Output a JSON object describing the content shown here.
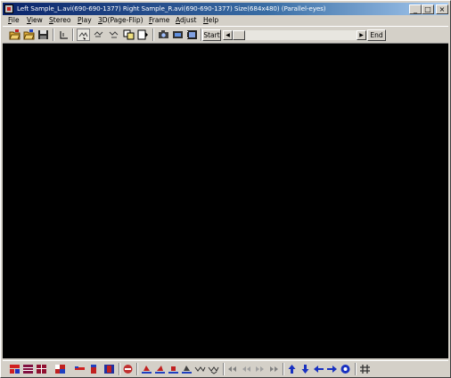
{
  "window": {
    "title": "Left Sample_L.avi(690-690-1377) Right Sample_R.avi(690-690-1377) Size(684x480)  (Parallel-eyes)",
    "controls": {
      "minimize": "_",
      "maximize": "□",
      "close": "×"
    }
  },
  "menu": [
    {
      "label": "File",
      "underline": "F",
      "rest": "ile"
    },
    {
      "label": "View",
      "underline": "V",
      "rest": "iew"
    },
    {
      "label": "Stereo",
      "underline": "S",
      "rest": "tereo"
    },
    {
      "label": "Play",
      "underline": "P",
      "rest": "lay"
    },
    {
      "label": "3D(Page-Flip)",
      "underline": "3",
      "rest": "D(Page-Flip)"
    },
    {
      "label": "Frame",
      "underline": "F",
      "rest": "rame"
    },
    {
      "label": "Adjust",
      "underline": "A",
      "rest": "djust"
    },
    {
      "label": "Help",
      "underline": "H",
      "rest": "elp"
    }
  ],
  "toolbar": {
    "start_label": "Start",
    "end_label": "End",
    "seek_position": 0,
    "icons": [
      "open-left-icon",
      "open-right-icon",
      "save-icon",
      "crop-icon",
      "swap-eyes-icon",
      "rotate-left-icon",
      "rotate-right-icon",
      "copy-frame-icon",
      "page-flip-icon",
      "camera-icon",
      "video-capture-icon",
      "film-icon"
    ]
  },
  "bottom_toolbar": {
    "icons": [
      "color-red-blue-icon",
      "color-red-cyan-icon",
      "color-red-green-icon",
      "palette-icon",
      "color-ribbon-icon",
      "anaglyph-gray-icon",
      "anaglyph-color-icon",
      "stop-icon",
      "align-left-icon",
      "align-right-icon",
      "align-up-icon",
      "align-down-icon",
      "wave-left-icon",
      "wave-right-icon",
      "go-first-icon",
      "step-back-icon",
      "step-forward-icon",
      "go-last-icon",
      "arrow-up-icon",
      "arrow-down-icon",
      "arrow-left-icon",
      "arrow-right-icon",
      "center-icon",
      "grid-icon"
    ]
  },
  "colors": {
    "title_start": "#0a246a",
    "title_end": "#a6caf0",
    "viewport": "#000000",
    "chrome": "#d4d0c8"
  }
}
